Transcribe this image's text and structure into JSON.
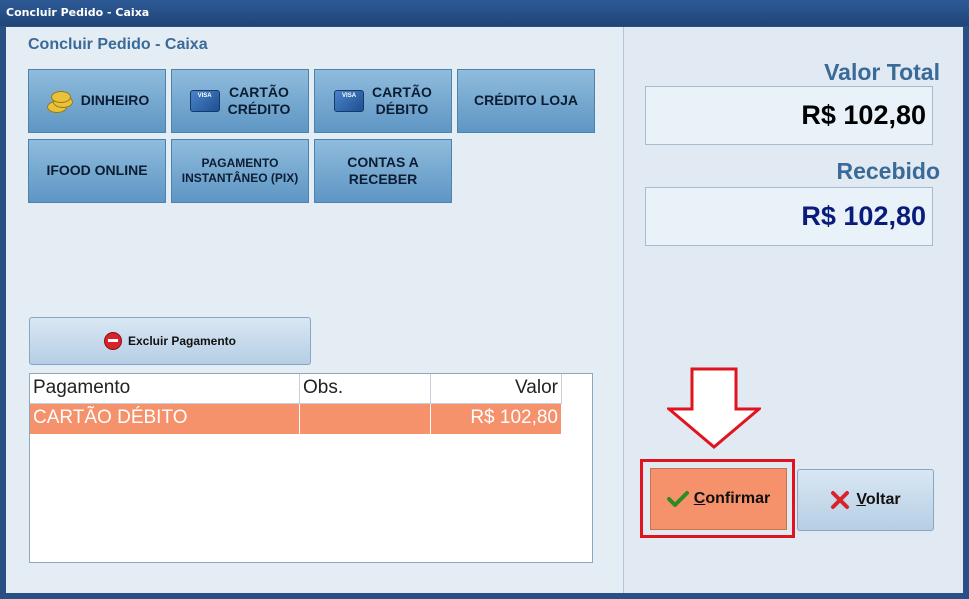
{
  "window": {
    "title": "Concluir Pedido - Caixa"
  },
  "heading": "Concluir Pedido - Caixa",
  "payment_methods": {
    "dinheiro": "DINHEIRO",
    "credito_l1": "CARTÃO",
    "credito_l2": "CRÉDITO",
    "debito_l1": "CARTÃO",
    "debito_l2": "DÉBITO",
    "credito_loja": "CRÉDITO LOJA",
    "ifood": "IFOOD ONLINE",
    "pix_l1": "PAGAMENTO",
    "pix_l2": "INSTANTÂNEO (PIX)",
    "contas_l1": "CONTAS A",
    "contas_l2": "RECEBER"
  },
  "excluir_label": "Excluir Pagamento",
  "table": {
    "headers": {
      "pagamento": "Pagamento",
      "obs": "Obs.",
      "valor": "Valor"
    },
    "rows": [
      {
        "pagamento": "CARTÃO DÉBITO",
        "obs": "",
        "valor": "R$ 102,80"
      }
    ]
  },
  "summary": {
    "valor_total_label": "Valor Total",
    "valor_total": "R$ 102,80",
    "recebido_label": "Recebido",
    "recebido": "R$ 102,80"
  },
  "actions": {
    "confirmar_first": "C",
    "confirmar_rest": "onfirmar",
    "voltar_first": "V",
    "voltar_rest": "oltar"
  },
  "colors": {
    "accent_orange": "#f5916b",
    "highlight_red": "#e0141e",
    "recebido_blue": "#0a1c7a"
  },
  "icons": {
    "dinheiro": "coins-icon",
    "cartao": "credit-card-icon",
    "excluir": "stop-icon",
    "confirmar": "check-icon",
    "voltar": "x-icon",
    "pointer": "down-arrow-icon"
  }
}
